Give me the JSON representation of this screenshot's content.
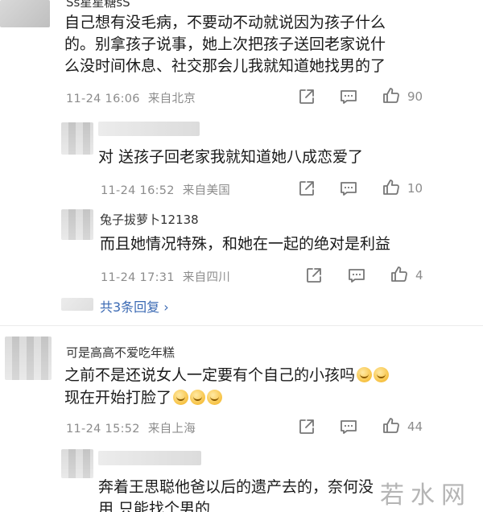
{
  "comments": [
    {
      "username": "Ss星星糖sS",
      "lines": [
        "自己想有没毛病，不要动不动就说因为孩子什么",
        "的。别拿孩子说事，她上次把孩子送回老家说什",
        "么没时间休息、社交那会儿我就知道她找男的了"
      ],
      "time": "11-24 16:06",
      "location": "来自北京",
      "likes": "90"
    },
    {
      "username": "",
      "lines": [
        "对 送孩子回老家我就知道她八成恋爱了"
      ],
      "time": "11-24 16:52",
      "location": "来自美国",
      "likes": "10"
    },
    {
      "username": "兔子拔萝卜12138",
      "lines": [
        "而且她情况特殊，和她在一起的绝对是利益"
      ],
      "time": "11-24 17:31",
      "location": "来自四川",
      "likes": "4"
    },
    {
      "username": "可是高高不爱吃年糕",
      "lines": [
        "之前不是还说女人一定要有个自己的小孩吗",
        "现在开始打脸了"
      ],
      "time": "11-24 15:52",
      "location": "来自上海",
      "likes": "44"
    },
    {
      "username": "",
      "lines": [
        "奔着王思聪他爸以后的遗产去的，奈何没",
        "用 只能找个男的"
      ],
      "time": "",
      "location": "",
      "likes": ""
    }
  ],
  "replies_link": "共3条回复 ›",
  "icons": [
    "share-icon",
    "comment-icon",
    "like-icon"
  ],
  "watermark": "若水网"
}
